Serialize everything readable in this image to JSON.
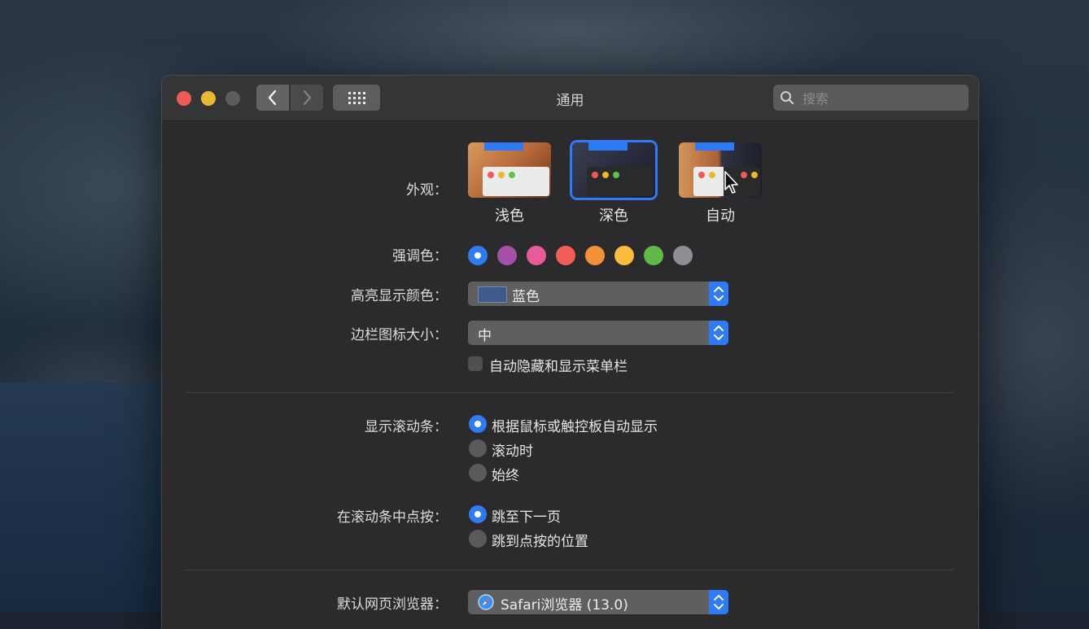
{
  "window": {
    "title": "通用",
    "search_placeholder": "搜索"
  },
  "appearance": {
    "label": "外观：",
    "options": [
      {
        "label": "浅色",
        "selected": false
      },
      {
        "label": "深色",
        "selected": true
      },
      {
        "label": "自动",
        "selected": false
      }
    ]
  },
  "accent": {
    "label": "强调色：",
    "colors": [
      "#2f7bf5",
      "#a550a7",
      "#e85b9b",
      "#f25d58",
      "#f29137",
      "#fbbc3b",
      "#62ba46",
      "#8e8e93"
    ],
    "selected_index": 0
  },
  "highlight": {
    "label": "高亮显示颜色：",
    "value": "蓝色"
  },
  "sidebar_icon_size": {
    "label": "边栏图标大小：",
    "value": "中"
  },
  "menubar": {
    "label": "自动隐藏和显示菜单栏",
    "checked": false
  },
  "scrollbars": {
    "label": "显示滚动条：",
    "options": [
      "根据鼠标或触控板自动显示",
      "滚动时",
      "始终"
    ],
    "selected_index": 0
  },
  "click_scrollbar": {
    "label": "在滚动条中点按：",
    "options": [
      "跳至下一页",
      "跳到点按的位置"
    ],
    "selected_index": 0
  },
  "browser": {
    "label": "默认网页浏览器：",
    "value": "Safari浏览器 (13.0)"
  },
  "icons": {
    "back": "chevron-left-icon",
    "forward": "chevron-right-icon",
    "grid": "grid-icon",
    "search": "search-icon",
    "stepper": "up-down-chevron-icon",
    "safari": "safari-compass-icon"
  }
}
